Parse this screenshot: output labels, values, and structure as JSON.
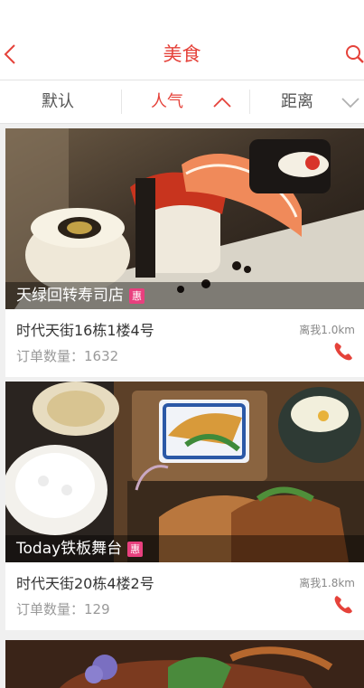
{
  "header": {
    "title": "美食"
  },
  "sort_tabs": [
    {
      "label": "默认",
      "active": false
    },
    {
      "label": "人气",
      "active": true,
      "arrow": "chevron-up-icon"
    },
    {
      "label": "距离",
      "active": false,
      "arrow": "chevron-down-icon"
    }
  ],
  "colors": {
    "accent": "#e5423a",
    "badge": "#e8407e",
    "text_secondary": "#9a9a9a"
  },
  "shops": [
    {
      "name": "天绿回转寿司店",
      "badge": "惠",
      "address": "时代天街16栋1楼4号",
      "distance": "离我1.0km",
      "orders": "订单数量：1632"
    },
    {
      "name": "Today铁板舞台",
      "badge": "惠",
      "address": "时代天街20栋4楼2号",
      "distance": "离我1.8km",
      "orders": "订单数量：129"
    }
  ]
}
